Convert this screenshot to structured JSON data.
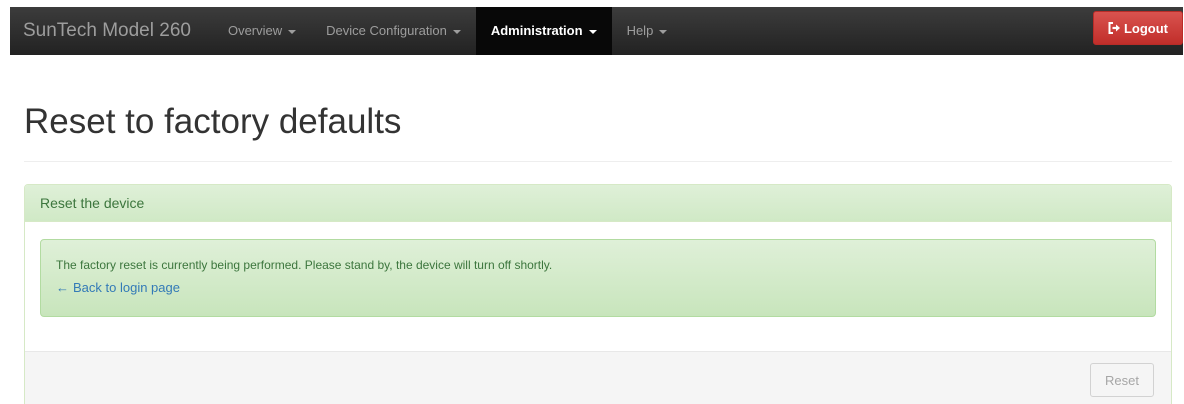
{
  "navbar": {
    "brand": "SunTech Model 260",
    "items": [
      {
        "label": "Overview"
      },
      {
        "label": "Device Configuration"
      },
      {
        "label": "Administration"
      },
      {
        "label": "Help"
      }
    ],
    "active_item": "Administration",
    "logout_label": "Logout",
    "logout_icon": "sign-out-icon"
  },
  "page": {
    "title": "Reset to factory defaults"
  },
  "panel": {
    "heading": "Reset the device",
    "alert_text": "The factory reset is currently being performed. Please stand by, the device will turn off shortly.",
    "back_link_arrow": "←",
    "back_link_label": "Back to login page",
    "reset_button_label": "Reset"
  },
  "colors": {
    "navbar_bg": "#222222",
    "logout_red": "#d9534f",
    "success_text": "#3c763d",
    "success_bg": "#dff0d8",
    "link_blue": "#337ab7"
  }
}
